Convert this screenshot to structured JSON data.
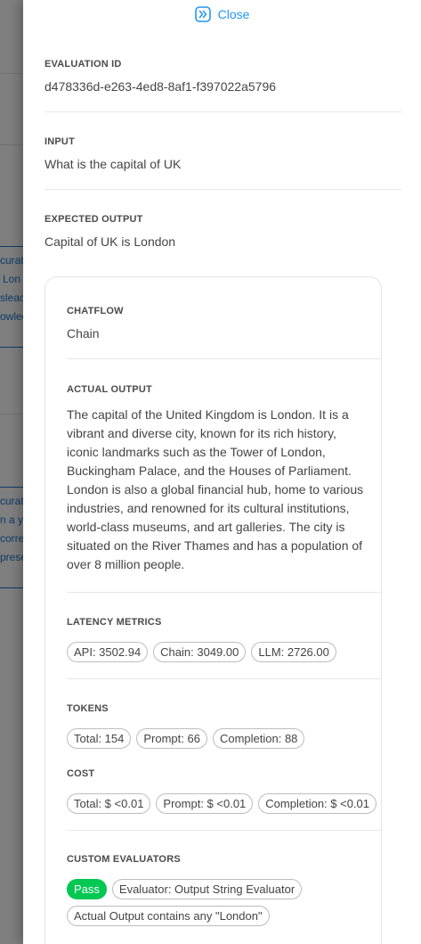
{
  "close_label": "Close",
  "evaluation_id": {
    "label": "EVALUATION ID",
    "value": "d478336d-e263-4ed8-8af1-f397022a5796"
  },
  "input": {
    "label": "INPUT",
    "value": "What is the capital of UK"
  },
  "expected_output": {
    "label": "EXPECTED OUTPUT",
    "value": "Capital of UK is London"
  },
  "chatflow": {
    "label": "CHATFLOW",
    "value": "Chain"
  },
  "actual_output": {
    "label": "ACTUAL OUTPUT",
    "value": "The capital of the United Kingdom is London. It is a vibrant and diverse city, known for its rich history, iconic landmarks such as the Tower of London, Buckingham Palace, and the Houses of Parliament. London is also a global financial hub, home to various industries, and renowned for its cultural institutions, world-class museums, and art galleries. The city is situated on the River Thames and has a population of over 8 million people."
  },
  "latency": {
    "label": "LATENCY METRICS",
    "chips": [
      "API: 3502.94",
      "Chain: 3049.00",
      "LLM: 2726.00"
    ]
  },
  "tokens": {
    "label": "TOKENS",
    "chips": [
      "Total: 154",
      "Prompt: 66",
      "Completion: 88"
    ]
  },
  "cost": {
    "label": "COST",
    "chips": [
      "Total: $ <0.01",
      "Prompt: $ <0.01",
      "Completion: $ <0.01"
    ]
  },
  "custom_evaluators": {
    "label": "CUSTOM EVALUATORS",
    "result": "Pass",
    "evaluator": "Evaluator: Output String Evaluator",
    "condition": "Actual Output contains any \"London\""
  },
  "background_fragments": [
    "curat",
    "Lon",
    "sleac",
    "owled",
    "curat",
    "n a y",
    "corre",
    "prese"
  ],
  "colors": {
    "accent": "#2196f3",
    "pass": "#00c853",
    "overlay": "rgba(0,0,0,0.5)"
  }
}
